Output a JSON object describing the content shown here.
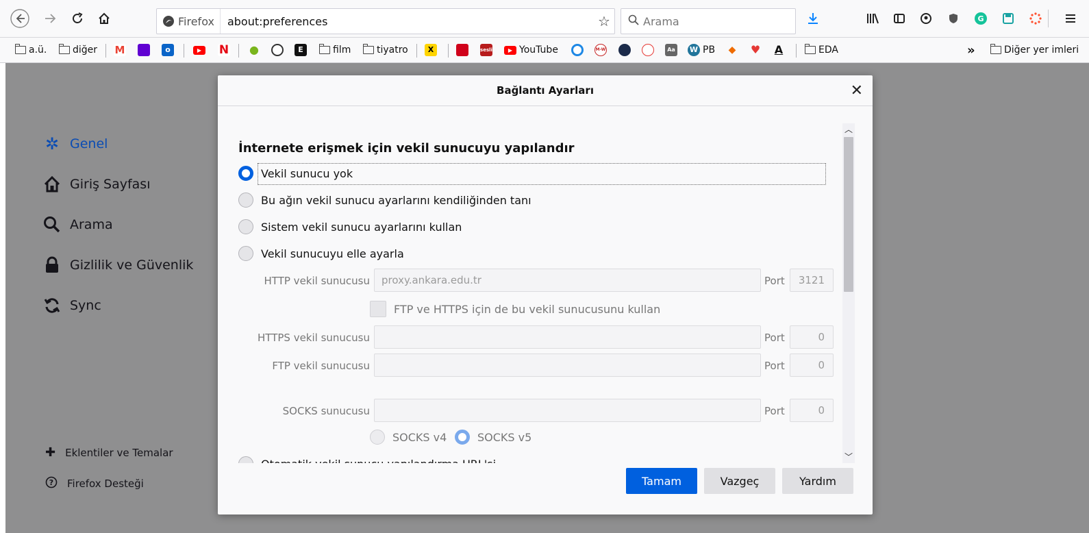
{
  "toolbar": {
    "identity_label": "Firefox",
    "url": "about:preferences",
    "search_placeholder": "Arama"
  },
  "bookmarks": {
    "items": [
      "a.ü.",
      "diğer",
      "film",
      "tiyatro",
      "YouTube",
      "PB",
      "EDA"
    ],
    "overflow_label": "Diğer yer imleri"
  },
  "sidebar": {
    "categories": [
      {
        "label": "Genel",
        "icon": "gear-icon",
        "selected": true
      },
      {
        "label": "Giriş Sayfası",
        "icon": "home-icon"
      },
      {
        "label": "Arama",
        "icon": "search-icon"
      },
      {
        "label": "Gizlilik ve Güvenlik",
        "icon": "lock-icon"
      },
      {
        "label": "Sync",
        "icon": "sync-icon"
      }
    ],
    "footer": [
      {
        "label": "Eklentiler ve Temalar",
        "icon": "puzzle-icon"
      },
      {
        "label": "Firefox Desteği",
        "icon": "help-icon"
      }
    ]
  },
  "dialog": {
    "title": "Bağlantı Ayarları",
    "section_title": "İnternete erişmek için vekil sunucuyu yapılandır",
    "radios": [
      {
        "label": "Vekil sunucu yok",
        "selected": true
      },
      {
        "label": "Bu ağın vekil sunucu ayarlarını kendiliğinden tanı"
      },
      {
        "label": "Sistem vekil sunucu ayarlarını kullan"
      },
      {
        "label": "Vekil sunucuyu elle ayarla"
      }
    ],
    "http_label": "HTTP vekil sunucusu",
    "http_value": "proxy.ankara.edu.tr",
    "http_port": "3121",
    "share_label": "FTP ve HTTPS için de bu vekil sunucusunu kullan",
    "https_label": "HTTPS vekil sunucusu",
    "https_port": "0",
    "ftp_label": "FTP vekil sunucusu",
    "ftp_port": "0",
    "socks_label": "SOCKS sunucusu",
    "socks_port": "0",
    "port_label": "Port",
    "socks_v4": "SOCKS v4",
    "socks_v5": "SOCKS v5",
    "auto_label_cut": "Otomatik vekil sunucu yapılandırma URL'si",
    "ok_label": "Tamam",
    "cancel_label": "Vazgeç",
    "help_label": "Yardım"
  },
  "colors": {
    "accent": "#0060df",
    "selected_category": "#0a4cb4",
    "overlay": "#8f8f90"
  }
}
